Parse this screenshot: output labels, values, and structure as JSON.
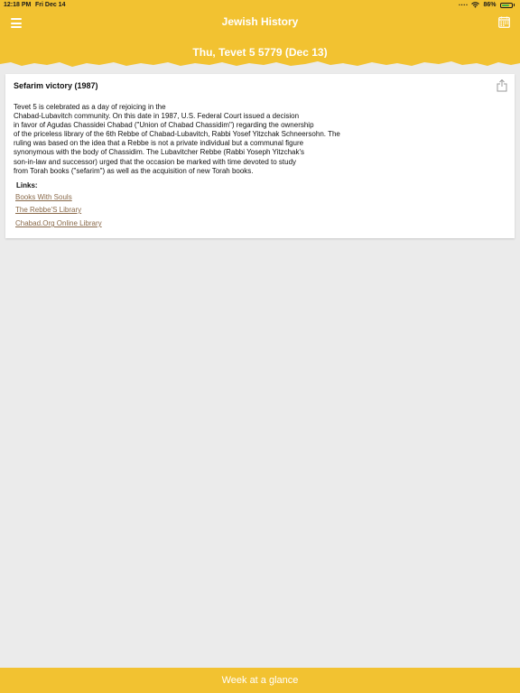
{
  "status_bar": {
    "time": "12:18 PM",
    "date": "Fri Dec 14",
    "battery": "86%",
    "battery_level": 0.86
  },
  "header": {
    "app_title": "Jewish History",
    "date_title": "Thu, Tevet 5 5779 (Dec 13)",
    "menu_icon": "hamburger-icon",
    "calendar_icon": "calendar-icon",
    "color": "#f2c231"
  },
  "article": {
    "title": "Sefarim victory (1987)",
    "share_icon": "share-icon",
    "body_lines": [
      "Tevet 5 is celebrated as a day of rejoicing in the",
      "Chabad-Lubavitch community. On this date in 1987, U.S. Federal Court issued a decision",
      "in favor of Agudas Chassidei Chabad (\"Union of Chabad Chassidim\") regarding the ownership",
      "of the priceless library of the 6th Rebbe of Chabad-Lubavitch, Rabbi Yosef Yitzchak Schneersohn. The",
      "ruling was based on the idea that a Rebbe is not a private individual but a communal figure",
      "synonymous with the body of Chassidim. The Lubavitcher Rebbe (Rabbi Yoseph Yitzchak's",
      "son-in-law and successor) urged that the occasion be marked with time devoted to study",
      "from Torah books (\"sefarim\") as well as the acquisition of new Torah books."
    ],
    "links_label": "Links:",
    "links": [
      "Books With Souls",
      "The Rebbe'S Library",
      "Chabad.Org Online Library"
    ]
  },
  "footer": {
    "label": "Week at a glance"
  }
}
